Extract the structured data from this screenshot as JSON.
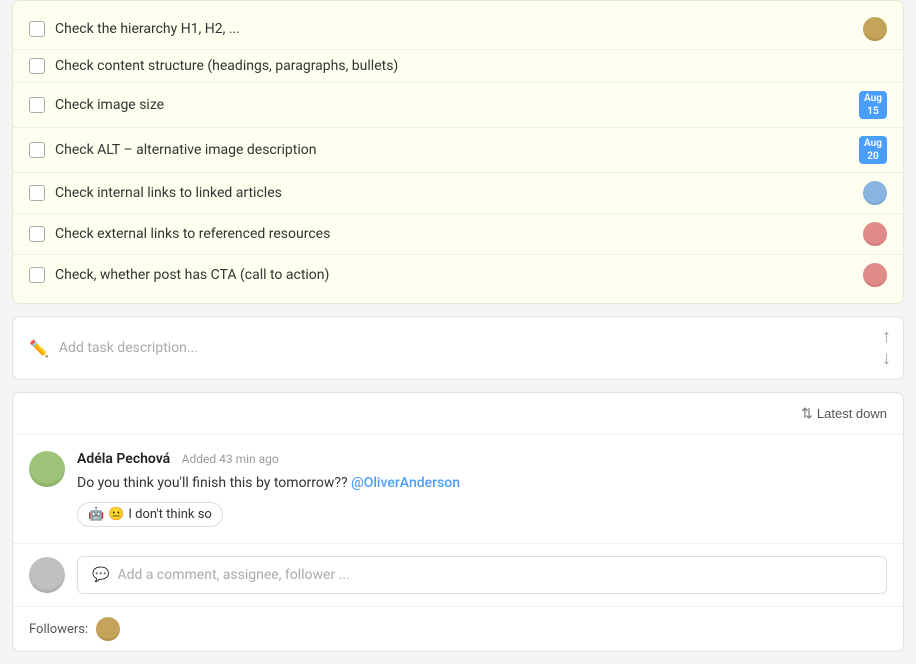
{
  "checklist": {
    "items": [
      {
        "id": 1,
        "label": "Check the hierarchy H1, H2, ...",
        "checked": false,
        "badge": null,
        "avatar": "face-1"
      },
      {
        "id": 2,
        "label": "Check content structure (headings, paragraphs, bullets)",
        "checked": false,
        "badge": null,
        "avatar": null
      },
      {
        "id": 3,
        "label": "Check image size",
        "checked": false,
        "badge": {
          "month": "Aug",
          "day": "15"
        },
        "avatar": null
      },
      {
        "id": 4,
        "label": "Check ALT – alternative image description",
        "checked": false,
        "badge": {
          "month": "Aug",
          "day": "20"
        },
        "avatar": null
      },
      {
        "id": 5,
        "label": "Check internal links to linked articles",
        "checked": false,
        "badge": null,
        "avatar": "face-2"
      },
      {
        "id": 6,
        "label": "Check external links to referenced resources",
        "checked": false,
        "badge": null,
        "avatar": "face-3"
      },
      {
        "id": 7,
        "label": "Check, whether post has CTA (call to action)",
        "checked": false,
        "badge": null,
        "avatar": "face-3"
      }
    ]
  },
  "description": {
    "placeholder": "Add task description..."
  },
  "comments": {
    "sort_label": "Latest down",
    "entries": [
      {
        "author": "Adéla Pechová",
        "time_label": "Added 43 min ago",
        "text": "Do you think you'll finish this by tomorrow??",
        "mention": "@OliverAnderson",
        "reaction": {
          "emoji1": "🤖",
          "emoji2": "😐",
          "text": "I don't think so"
        },
        "avatar_class": "face-adela"
      }
    ],
    "add_comment_placeholder": "Add a comment, assignee, follower ...",
    "followers_label": "Followers:"
  }
}
